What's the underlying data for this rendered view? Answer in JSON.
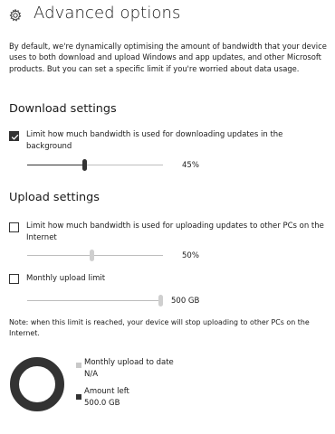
{
  "header": {
    "title": "Advanced options",
    "icon": "gear-icon"
  },
  "intro_text": "By default, we're dynamically optimising the amount of bandwidth that your device uses to both download and upload Windows and app updates, and other Microsoft products. But you can set a specific limit if you're worried about data usage.",
  "download": {
    "heading": "Download settings",
    "limit_checkbox": {
      "label": "Limit how much bandwidth is used for downloading updates in the background",
      "checked": true
    },
    "slider": {
      "value": 45,
      "unit": "%",
      "display": "45%"
    }
  },
  "upload": {
    "heading": "Upload settings",
    "limit_checkbox": {
      "label": "Limit how much bandwidth is used for uploading updates to other PCs on the Internet",
      "checked": false
    },
    "slider": {
      "value": 50,
      "unit": "%",
      "display": "50%",
      "disabled": true
    },
    "monthly_checkbox": {
      "label": "Monthly upload limit",
      "checked": false
    },
    "monthly_slider": {
      "display": "500 GB",
      "value_fraction": 1.0,
      "disabled": true
    }
  },
  "note_text": "Note: when this limit is reached, your device will stop uploading to other PCs on the Internet.",
  "usage": {
    "monthly_upload_label": "Monthly upload to date",
    "monthly_upload_value": "N/A",
    "amount_left_label": "Amount left",
    "amount_left_value": "500.0 GB",
    "colors": {
      "used": "#c8c8c8",
      "left": "#333333"
    }
  }
}
